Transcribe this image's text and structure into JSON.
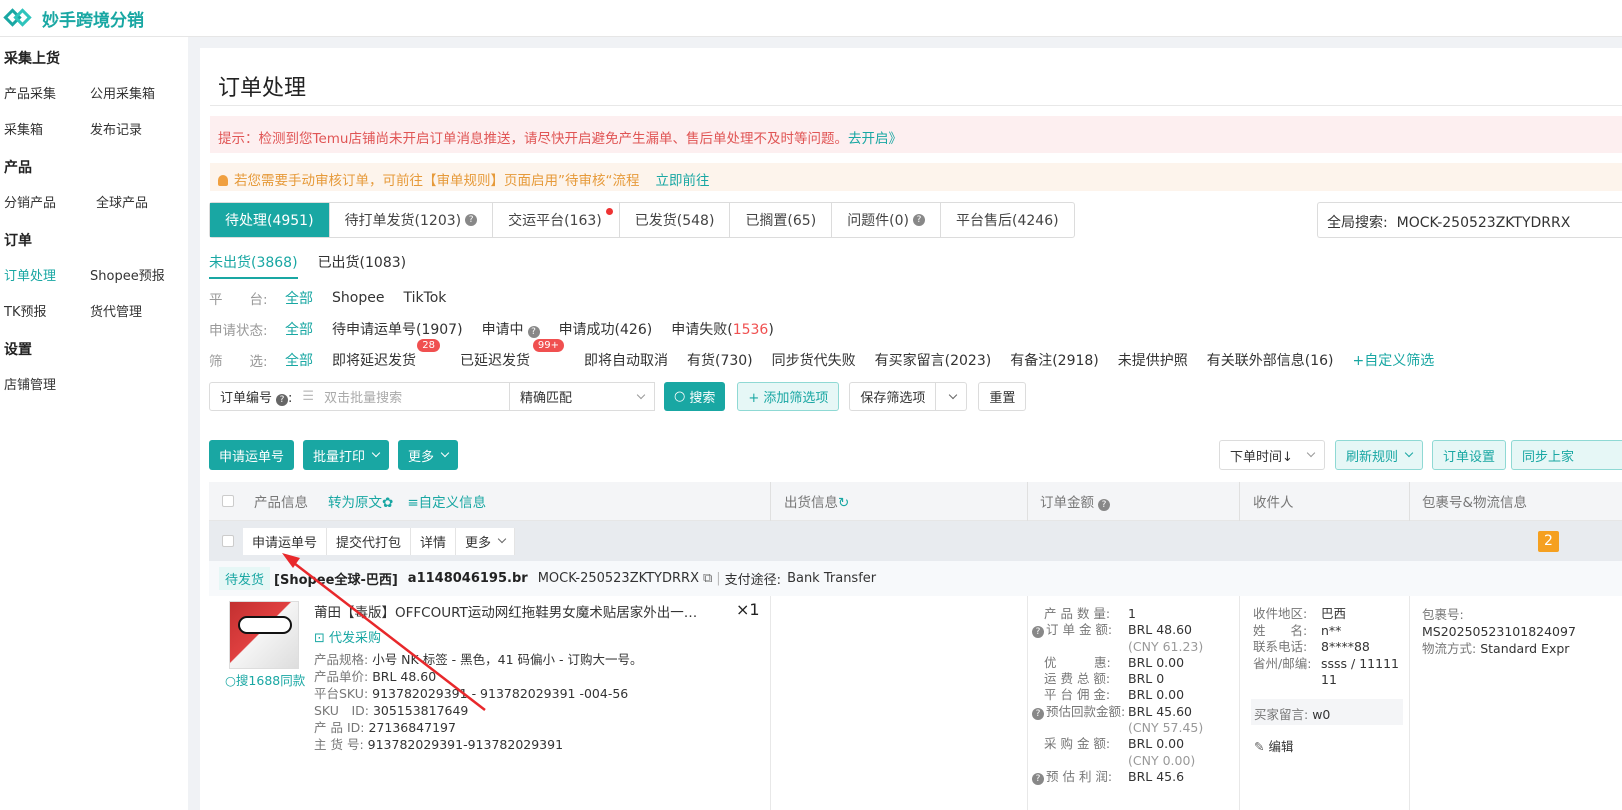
{
  "app": {
    "name": "妙手跨境分销"
  },
  "sidebar": {
    "groups": [
      {
        "title": "采集上货",
        "rows": [
          [
            "产品采集",
            "公用采集箱"
          ],
          [
            "采集箱",
            "发布记录"
          ]
        ]
      },
      {
        "title": "产品",
        "rows": [
          [
            "分销产品",
            "全球产品"
          ]
        ]
      },
      {
        "title": "订单",
        "rows": [
          [
            "订单处理",
            "Shopee预报"
          ],
          [
            "TK预报",
            "货代管理"
          ]
        ]
      },
      {
        "title": "设置",
        "rows": [
          [
            "店铺管理",
            ""
          ]
        ]
      }
    ]
  },
  "page": {
    "title": "订单处理",
    "notice_red": "提示：检测到您Temu店铺尚未开启订单消息推送，请尽快开启避免产生漏单、售后单处理不及时等问题。",
    "notice_red_link": "去开启》",
    "notice_orange": "若您需要手动审核订单，可前往【审单规则】页面启用”待审核“流程",
    "notice_orange_link": "立即前往"
  },
  "tabs": [
    {
      "label": "待处理(4951)"
    },
    {
      "label": "待打单发货(1203)"
    },
    {
      "label": "交运平台(163)"
    },
    {
      "label": "已发货(548)"
    },
    {
      "label": "已搁置(65)"
    },
    {
      "label": "问题件(0)"
    },
    {
      "label": "平台售后(4246)"
    }
  ],
  "global_search": {
    "label": "全局搜索:",
    "value": "MOCK-250523ZKTYDRRX"
  },
  "subtabs": [
    "未出货(3868)",
    "已出货(1083)"
  ],
  "filters": {
    "platform": {
      "label": "平　　台:",
      "items": [
        "全部",
        "Shopee",
        "TikTok"
      ]
    },
    "apply_status": {
      "label": "申请状态:",
      "items": [
        "全部",
        "待申请运单号(1907)",
        "申请中",
        "申请成功(426)",
        "申请失败("
      ],
      "fail_count": "1536",
      "fail_close": ")"
    },
    "screen": {
      "label": "筛　　选:",
      "items": [
        "全部",
        "即将延迟发货",
        "已延迟发货",
        "即将自动取消",
        "有货(730)",
        "同步货代失败",
        "有买家留言(2023)",
        "有备注(2918)",
        "未提供护照",
        "有关联外部信息(16)",
        "+自定义筛选"
      ],
      "badge1": "28",
      "badge2": "99+"
    }
  },
  "search": {
    "field_label": "订单编号",
    "placeholder": "双击批量搜索",
    "match": "精确匹配",
    "search_btn": "搜索",
    "add_filter": "+ 添加筛选项",
    "save_filter": "保存筛选项",
    "reset": "重置"
  },
  "actions": {
    "apply_waybill": "申请运单号",
    "batch_print": "批量打印",
    "more": "更多",
    "sort": "下单时间↓",
    "refresh_rule": "刷新规则",
    "order_settings": "订单设置",
    "sync": "同步上家"
  },
  "table": {
    "headers": {
      "product": "产品信息",
      "to_original": "转为原文",
      "custom_info": "≡自定义信息",
      "shipping": "出货信息",
      "amount": "订单金额",
      "receiver": "收件人",
      "package": "包裹号&物流信息"
    }
  },
  "order": {
    "actions": [
      "申请运单号",
      "提交代打包",
      "详情",
      "更多"
    ],
    "badge": "2",
    "status": "待发货",
    "shop": "[Shopee全球-巴西]",
    "buyer": "a1148046195.br",
    "order_no": "MOCK-250523ZKTYDRRX",
    "pay_label": "支付途径:",
    "pay_value": "Bank Transfer",
    "product": {
      "title": "莆田【毒版】OFFCOURT运动网红拖鞋男女魔术贴居家外出一…",
      "qty": "×1",
      "purchase": "代发采购",
      "search1688": "搜1688同款",
      "spec_k": "产品规格:",
      "spec_v": "小号 NK 标签 - 黑色，41 码偏小 - 订购大一号。",
      "price_k": "产品单价:",
      "price_v": "BRL 48.60",
      "psku_k": "平台SKU:",
      "psku_v": "913782029391 - 913782029391 -004-56",
      "skuid_k": "SKU　ID:",
      "skuid_v": "305153817649",
      "pid_k": "产 品 ID:",
      "pid_v": "27136847197",
      "main_k": "主 货 号:",
      "main_v": "913782029391-913782029391"
    },
    "amounts": [
      {
        "k": "产 品 数 量:",
        "v": "1"
      },
      {
        "k": "订 单 金 额:",
        "v": "BRL 48.60",
        "sub": "(CNY 61.23)"
      },
      {
        "k": "优　　　惠:",
        "v": "BRL 0.00"
      },
      {
        "k": "运 费 总 额:",
        "v": "BRL 0"
      },
      {
        "k": "平 台 佣 金:",
        "v": "BRL 0.00"
      },
      {
        "k": "预估回款金额:",
        "v": "BRL 45.60",
        "sub": "(CNY 57.45)"
      },
      {
        "k": "采 购 金 额:",
        "v": "BRL 0.00",
        "sub": "(CNY 0.00)"
      },
      {
        "k": "预 估 利 润:",
        "v": "BRL 45.6"
      }
    ],
    "receiver": {
      "region_k": "收件地区:",
      "region_v": "巴西",
      "name_k": "姓　　名:",
      "name_v": "n**",
      "phone_k": "联系电话:",
      "phone_v": "8****88",
      "zip_k": "省州/邮编:",
      "zip_v": "ssss / 11111",
      "zip_v2": "11",
      "msg_k": "买家留言:",
      "msg_v": "w0",
      "edit": "编辑"
    },
    "package": {
      "no_k": "包裹号:",
      "no_v": "MS20250523101824097",
      "ship_k": "物流方式:",
      "ship_v": "Standard Expr"
    }
  }
}
